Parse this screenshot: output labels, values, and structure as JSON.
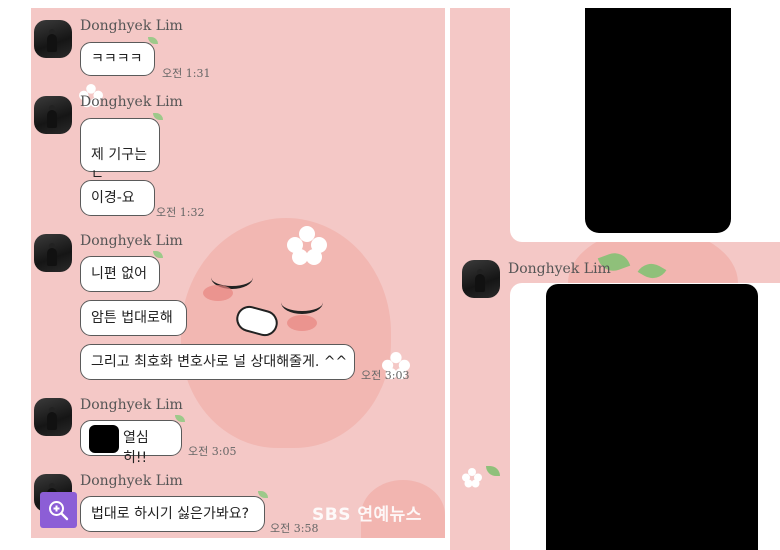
{
  "left_chat": {
    "messages": [
      {
        "sender": "Donghyek Lim",
        "bubbles": [
          "ㅋㅋㅋㅋ"
        ],
        "time": "오전 1:31"
      },
      {
        "sender": "Donghyek Lim",
        "bubbles": [
          "제 기구는\nㄴ",
          "이경-요"
        ],
        "time": "오전 1:32"
      },
      {
        "sender": "Donghyek Lim",
        "bubbles": [
          "니편 없어",
          "암튼 법대로해",
          "그리고 최호화 변호사로 널 상대해줄게. ^^"
        ],
        "time": "오전 3:03"
      },
      {
        "sender": "Donghyek Lim",
        "bubbles": [
          "열심히!!"
        ],
        "time": "오전 3:05"
      },
      {
        "sender": "Donghyek Lim",
        "bubbles": [
          "법대로 하시기 싫은가봐요?"
        ],
        "time": "오전 3:58"
      }
    ]
  },
  "right_chat": {
    "sender": "Donghyek Lim"
  },
  "watermark": "SBS 연예뉴스",
  "icons": {
    "zoom": "zoom-in-icon"
  },
  "colors": {
    "chat_background": "#f4c8c6",
    "zoom_button": "#8c5ed6"
  }
}
